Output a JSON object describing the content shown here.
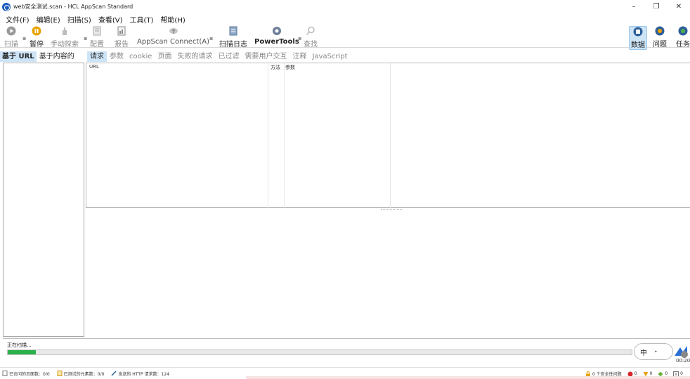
{
  "window": {
    "title": "web安全测试.scan - HCL AppScan Standard",
    "controls": [
      "–",
      "❐",
      "✕"
    ]
  },
  "menu": [
    "文件(F)",
    "编辑(E)",
    "扫描(S)",
    "查看(V)",
    "工具(T)",
    "帮助(H)"
  ],
  "toolbar": {
    "scan": "扫描",
    "pause": "暂停",
    "manual_explore": "手动探索",
    "config": "配置",
    "report": "报告",
    "appscan_connect": "AppScan Connect(A)",
    "scan_log": "扫描日志",
    "powertools": "PowerTools",
    "find": "查找",
    "data": "数据",
    "issues": "问题",
    "tasks": "任务"
  },
  "left_tabs": [
    "基于 URL",
    "基于内容的"
  ],
  "right_tabs": [
    "请求",
    "参数",
    "cookie",
    "页面",
    "失败的请求",
    "已过滤",
    "需要用户交互",
    "注释",
    "JavaScript"
  ],
  "grid": {
    "col_url": "URL",
    "col_method": "方法",
    "col_params": "参数"
  },
  "progress": {
    "status": "正在扫描...",
    "fraction": 0.045
  },
  "ime": {
    "char": "中",
    "dot": "•",
    "timer": "00:20"
  },
  "statusbar": {
    "visited_urls": "已访问的页面数：0/0",
    "tested_elements": "已测试的元素数：0/0",
    "http_requests": "发送的 HTTP 请求数：124",
    "security_issues": "0 个安全性问题",
    "high": "0",
    "medium": "0",
    "low": "0",
    "info": "0"
  },
  "colors": {
    "accent": "#cde4f7",
    "progress": "#2ab24a",
    "high": "#d9262b",
    "medium": "#e8a317",
    "low": "#6bb43c"
  }
}
